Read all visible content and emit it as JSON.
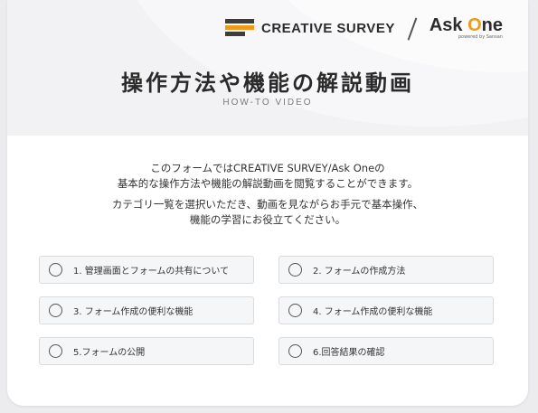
{
  "header": {
    "brand_primary": "CREATIVE SURVEY",
    "brand_secondary_part1": "Ask",
    "brand_secondary_part2_o": "O",
    "brand_secondary_part2_rest": "ne",
    "brand_secondary_sub": "powered by Sansan",
    "title": "操作方法や機能の解説動画",
    "subtitle": "HOW-TO VIDEO",
    "accent_color": "#f09a1a"
  },
  "description": {
    "para1_line1": "このフォームではCREATIVE SURVEY/Ask Oneの",
    "para1_line2": "基本的な操作方法や機能の解説動画を閲覧することができます。",
    "para2_line1": "カテゴリ一覧を選択いただき、動画を見ながらお手元で基本操作、",
    "para2_line2": "機能の学習にお役立てください。"
  },
  "options": [
    {
      "label": "1. 管理画面とフォームの共有について",
      "selected": false
    },
    {
      "label": "2. フォームの作成方法",
      "selected": false
    },
    {
      "label": "3. フォーム作成の便利な機能",
      "selected": false
    },
    {
      "label": "4. フォーム作成の便利な機能",
      "selected": false
    },
    {
      "label": "5.フォームの公開",
      "selected": false
    },
    {
      "label": "6.回答結果の確認",
      "selected": false
    }
  ]
}
